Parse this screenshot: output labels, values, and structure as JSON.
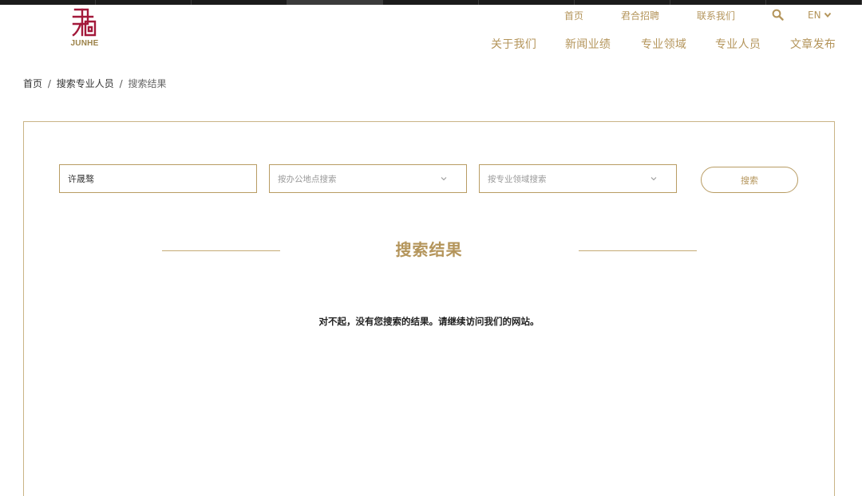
{
  "header": {
    "logo_text": "JUNHE",
    "utility_links": [
      "首页",
      "君合招聘",
      "联系我们"
    ],
    "language": "EN",
    "main_nav": [
      "关于我们",
      "新闻业绩",
      "专业领域",
      "专业人员",
      "文章发布"
    ]
  },
  "breadcrumb": {
    "home": "首页",
    "parent": "搜索专业人员",
    "current": "搜索结果",
    "separator": "/"
  },
  "search": {
    "name_value": "许晟骜",
    "office_placeholder": "按办公地点搜索",
    "field_placeholder": "按专业领域搜索",
    "button_label": "搜索"
  },
  "results": {
    "heading": "搜索结果",
    "message": "对不起，没有您搜索的结果。请继续访问我们的网站。"
  },
  "colors": {
    "accent": "#b4955b",
    "logo_red": "#a3193a",
    "border": "#c9b486",
    "top_bar": "#1b1b1b"
  },
  "icons": {
    "search": "search-icon",
    "lang_dropdown": "chevron-down-icon",
    "select_dropdown": "chevron-down-icon"
  }
}
